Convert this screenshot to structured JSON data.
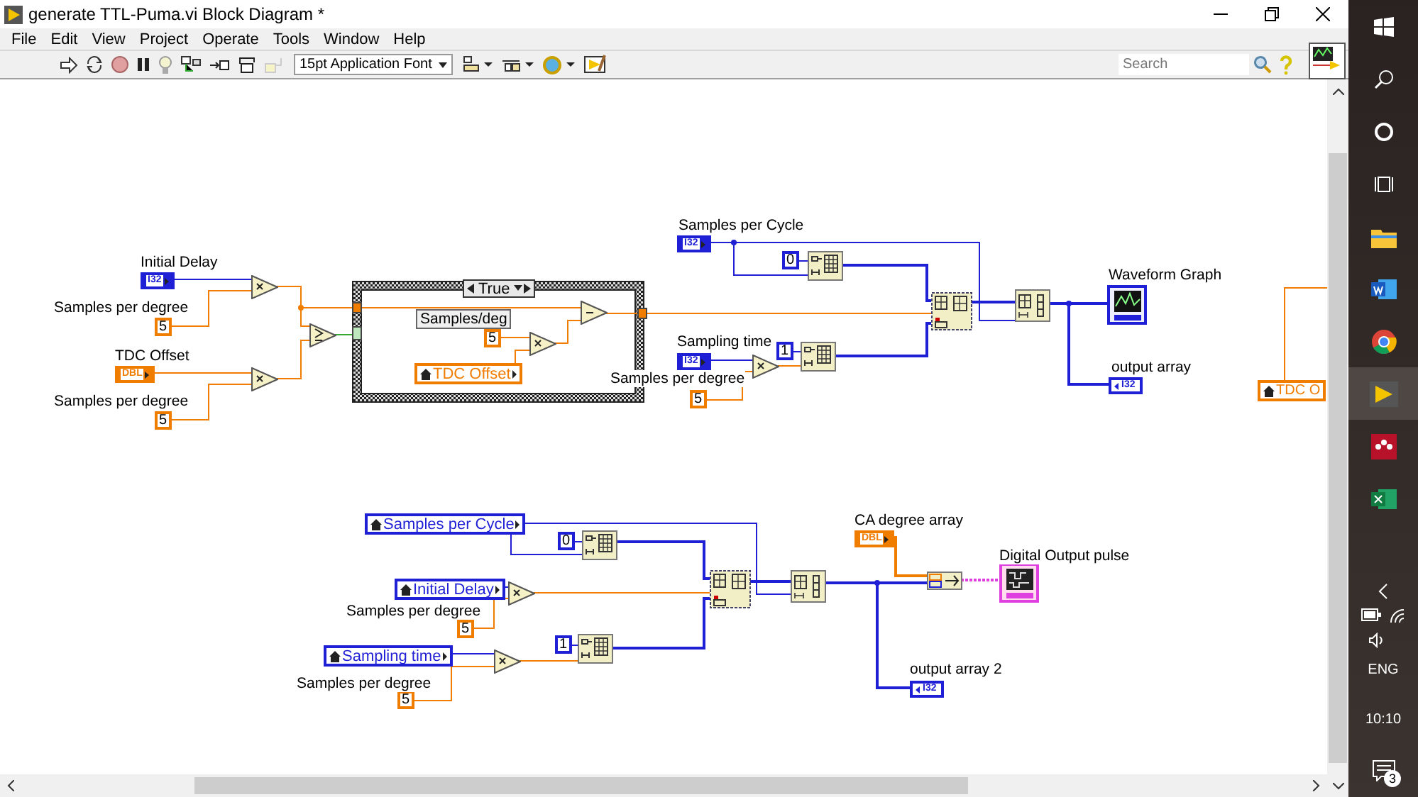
{
  "window": {
    "title": "generate TTL-Puma.vi Block Diagram *"
  },
  "menu": [
    "File",
    "Edit",
    "View",
    "Project",
    "Operate",
    "Tools",
    "Window",
    "Help"
  ],
  "toolbar": {
    "font": "15pt Application Font"
  },
  "search": {
    "placeholder": "Search"
  },
  "diagram": {
    "labels": [
      {
        "text": "Initial Delay",
        "kind": "free"
      },
      {
        "text": "Samples per degree",
        "kind": "free"
      },
      {
        "text": "TDC Offset",
        "kind": "free"
      },
      {
        "text": "Samples per degree",
        "kind": "free"
      },
      {
        "text": "Samples/deg",
        "kind": "boxed"
      },
      {
        "text": "Samples per Cycle",
        "kind": "free"
      },
      {
        "text": "Waveform Graph",
        "kind": "free"
      },
      {
        "text": "Sampling time",
        "kind": "free"
      },
      {
        "text": "Samples per degree",
        "kind": "free"
      },
      {
        "text": "output array",
        "kind": "free"
      },
      {
        "text": "CA degree array",
        "kind": "free"
      },
      {
        "text": "Digital Output pulse",
        "kind": "free"
      },
      {
        "text": "Samples per degree",
        "kind": "free"
      },
      {
        "text": "output array 2",
        "kind": "free"
      },
      {
        "text": "Samples per degree",
        "kind": "free"
      }
    ],
    "terminals": [
      {
        "kind": "control",
        "type": "I32"
      },
      {
        "kind": "control",
        "type": "DBL"
      },
      {
        "kind": "control",
        "type": "I32"
      },
      {
        "kind": "graph"
      },
      {
        "kind": "control",
        "type": "I32"
      },
      {
        "kind": "indicator",
        "type": "I32"
      },
      {
        "kind": "control",
        "type": "DBL"
      },
      {
        "kind": "digital"
      },
      {
        "kind": "indicator",
        "type": "I32"
      }
    ],
    "constants": [
      {
        "value": "5",
        "kind": "float"
      },
      {
        "value": "5",
        "kind": "float"
      },
      {
        "value": "5",
        "kind": "float"
      },
      {
        "value": "0",
        "kind": "integer"
      },
      {
        "value": "1",
        "kind": "integer"
      },
      {
        "value": "5",
        "kind": "float"
      },
      {
        "value": "0",
        "kind": "integer"
      },
      {
        "value": "5",
        "kind": "float"
      },
      {
        "value": "1",
        "kind": "integer"
      },
      {
        "value": "5",
        "kind": "float"
      }
    ],
    "local_variables": [
      {
        "name": "TDC Offset",
        "kind": "float"
      },
      {
        "name": "TDC O",
        "kind": "float"
      },
      {
        "name": "Samples per Cycle",
        "kind": "integer"
      },
      {
        "name": "Initial Delay",
        "kind": "integer"
      },
      {
        "name": "Sampling time",
        "kind": "integer"
      }
    ],
    "case_structure": {
      "selector": "True"
    },
    "functions": [
      {
        "kind": "multiply"
      },
      {
        "kind": "multiply"
      },
      {
        "kind": "greater-or-equal"
      },
      {
        "kind": "multiply"
      },
      {
        "kind": "subtract"
      },
      {
        "kind": "initialize-array"
      },
      {
        "kind": "multiply"
      },
      {
        "kind": "initialize-array"
      },
      {
        "kind": "build-array"
      },
      {
        "kind": "reshape-array"
      },
      {
        "kind": "initialize-array"
      },
      {
        "kind": "multiply"
      },
      {
        "kind": "multiply"
      },
      {
        "kind": "initialize-array"
      },
      {
        "kind": "build-array"
      },
      {
        "kind": "reshape-array"
      },
      {
        "kind": "convert"
      }
    ]
  },
  "taskbar": {
    "language": "ENG",
    "time": "10:10",
    "notifications": "3"
  }
}
